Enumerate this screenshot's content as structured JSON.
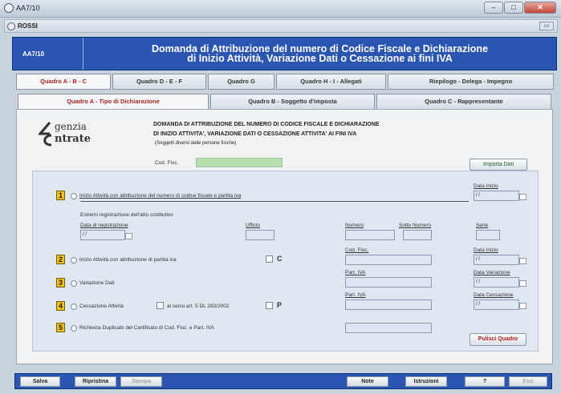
{
  "window": {
    "title": "AA7/10",
    "min": "–",
    "max": "□",
    "close": "✕"
  },
  "inner": {
    "title": "ROSSI",
    "btn": "▭"
  },
  "header": {
    "code": "AA7/10",
    "title_line1": "Domanda di Attribuzione del numero di Codice Fiscale e Dichiarazione",
    "title_line2": "di Inizio Attività, Variazione Dati o Cessazione ai fini IVA"
  },
  "main_tabs": [
    "Quadro A - B - C",
    "Quadro D - E - F",
    "Quadro G",
    "Quadro H - I - Allegati",
    "Riepilogo - Delega - Impegno"
  ],
  "sub_tabs": [
    "Quadro  A - Tipo di Dichiarazione",
    "Quadro B - Soggetto d'imposta",
    "Quadro C - Rappresentante"
  ],
  "logo": {
    "line1": "genzia",
    "line2": "ntrate"
  },
  "doc": {
    "line1": "DOMANDA DI ATTRIBUZIONE DEL NUMERO DI CODICE FISCALE E DICHIARAZIONE",
    "line2": "DI INIZIO ATTIVITA', VARIAZIONE DATI O CESSAZIONE ATTIVITA' AI FINI IVA",
    "line3": "(Soggetti diversi dalle persone fisiche)",
    "codfisc_label": "Cod. Fisc.",
    "import_btn": "Importa Dati"
  },
  "section1": {
    "num": "1",
    "label": "Inizio Attività con attribuzione del  numero di codice fiscale e partita iva",
    "date_label": "Data Inizio",
    "date_val": "/ /",
    "estremi": "Estremi registrazione dell'atto costitutivo",
    "data_reg": "Data di registrazione",
    "ufficio": "Ufficio",
    "numero": "Numero",
    "sottonumero": "Sotto Numero",
    "serie": "Serie"
  },
  "section2": {
    "num": "2",
    "label": "Inizio Attività con attribuzione di partita iva",
    "chk": "C",
    "codfisc": "Cod. Fisc.",
    "date_label": "Data Inizio"
  },
  "section3": {
    "num": "3",
    "label": "Variazione Dati",
    "piva": "Part. IVA",
    "date_label": "Data Variazione"
  },
  "section4": {
    "num": "4",
    "label": "Cessazione Attività",
    "art": "ai sensi art. 5 DL 282/2002",
    "chk": "P",
    "piva": "Part. IVA",
    "date_label": "Data Cessazione"
  },
  "section5": {
    "num": "5",
    "label": "Richiesta Duplicato del Certificato di Cod. Fisc. e Part. IVA",
    "clear_btn": "Pulisci Quadro"
  },
  "bottom": {
    "salva": "Salva",
    "ripristina": "Ripristina",
    "stampa": "Stampa",
    "note": "Note",
    "istruzioni": "Istruzioni",
    "help": "?",
    "esci": "Esci"
  }
}
